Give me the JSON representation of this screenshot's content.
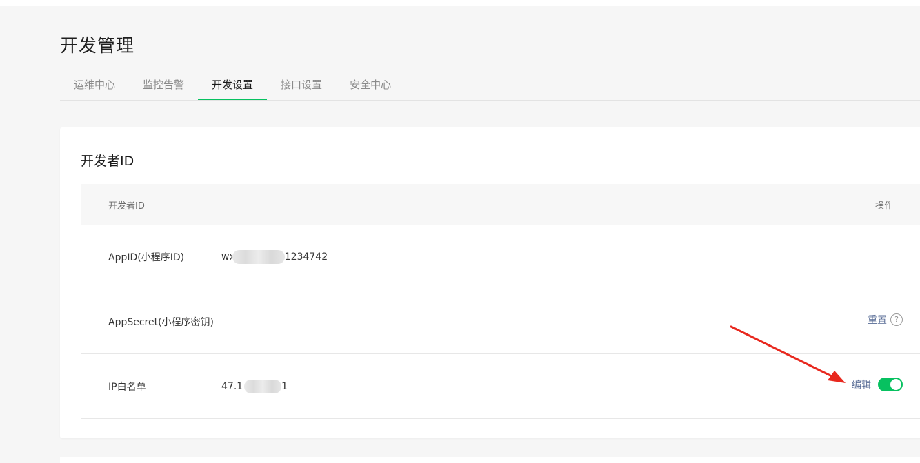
{
  "page": {
    "title": "开发管理"
  },
  "tabs": [
    {
      "label": "运维中心",
      "active": false
    },
    {
      "label": "监控告警",
      "active": false
    },
    {
      "label": "开发设置",
      "active": true
    },
    {
      "label": "接口设置",
      "active": false
    },
    {
      "label": "安全中心",
      "active": false
    }
  ],
  "card": {
    "title": "开发者ID",
    "table": {
      "header_left": "开发者ID",
      "header_right": "操作",
      "rows": [
        {
          "label": "AppID(小程序ID)",
          "value_prefix": "wx",
          "value_suffix": "1234742"
        },
        {
          "label": "AppSecret(小程序密钥)",
          "action": "重置",
          "help_icon": "question-circle-icon"
        },
        {
          "label": "IP白名单",
          "value_prefix": "47.1",
          "value_suffix": "1",
          "action": "编辑",
          "toggle_on": true
        }
      ]
    }
  },
  "colors": {
    "accent": "#07c160",
    "link": "#576b95",
    "annotation_arrow": "#e8281e"
  }
}
